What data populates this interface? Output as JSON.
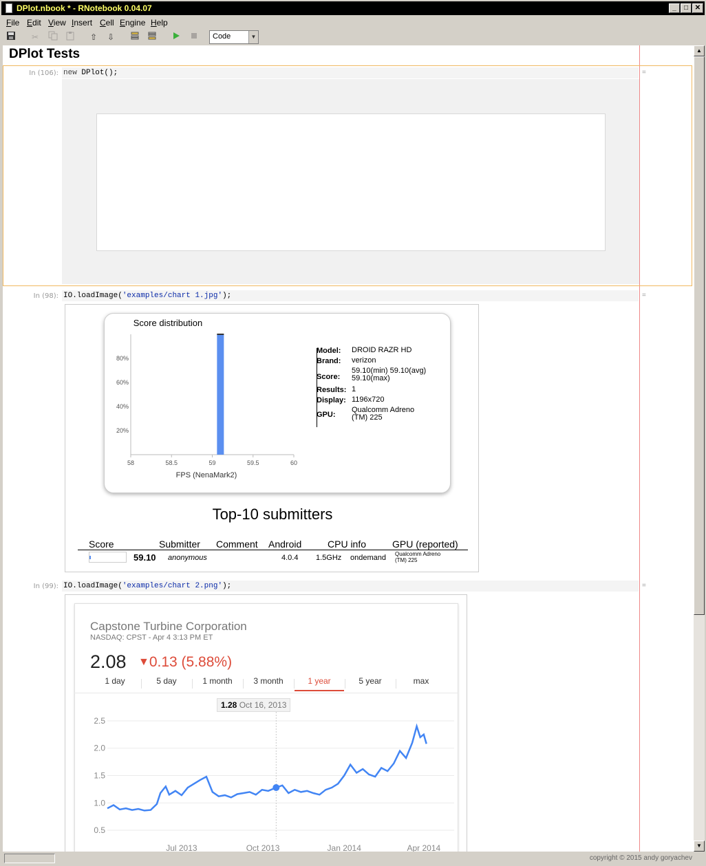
{
  "window": {
    "title": "DPlot.nbook * - RNotebook 0.04.07",
    "controls": {
      "minimize": "_",
      "maximize": "□",
      "close": "✕"
    }
  },
  "menu": [
    "File",
    "Edit",
    "View",
    "Insert",
    "Cell",
    "Engine",
    "Help"
  ],
  "toolbar": {
    "icons": [
      "save-icon",
      "cut-icon",
      "copy-icon",
      "paste-icon",
      "move-up-icon",
      "move-down-icon",
      "insert-above-icon",
      "insert-below-icon",
      "run-icon",
      "stop-icon"
    ],
    "cell_type": "Code"
  },
  "notebook": {
    "title": "DPlot Tests",
    "cells": [
      {
        "prompt": "In (106):",
        "code_kw": "new",
        "code_rest": " DPlot();",
        "marker": "="
      },
      {
        "prompt": "In (98):",
        "code_pre": "IO.loadImage(",
        "code_str": "'examples/chart 1.jpg'",
        "code_post": ");",
        "marker": "="
      },
      {
        "prompt": "In (99):",
        "code_pre": "IO.loadImage(",
        "code_str": "'examples/chart 2.png'",
        "code_post": ");",
        "marker": "="
      }
    ]
  },
  "image1": {
    "info": [
      {
        "key": "Model:",
        "value": "DROID RAZR HD"
      },
      {
        "key": "Brand:",
        "value": "verizon"
      },
      {
        "key": "Score:",
        "value": "59.10(min) 59.10(avg) 59.10(max)"
      },
      {
        "key": "Results:",
        "value": "1"
      },
      {
        "key": "Display:",
        "value": "1196x720"
      },
      {
        "key": "GPU:",
        "value": "Qualcomm Adreno (TM) 225"
      }
    ],
    "top10_title": "Top-10 submitters",
    "table_headers": [
      "Score",
      "Submitter",
      "Comment",
      "Android",
      "CPU info",
      "GPU (reported)"
    ],
    "table_row": {
      "score": "59.10",
      "submitter": "anonymous",
      "android": "4.0.4",
      "cpu_freq": "1.5GHz",
      "cpu_gov": "ondemand",
      "gpu": "Qualcomm Adreno (TM) 225"
    }
  },
  "image2": {
    "company": "Capstone Turbine Corporation",
    "exchange": "NASDAQ: CPST - Apr 4 3:13 PM ET",
    "price": "2.08",
    "change": "0.13 (5.88%)",
    "change_color": "#dd4b39",
    "tabs": [
      "1 day",
      "5 day",
      "1 month",
      "3 month",
      "1 year",
      "5 year",
      "max"
    ],
    "active_tab": "1 year",
    "tooltip_value": "1.28",
    "tooltip_date": "Oct 16, 2013"
  },
  "chart_data": [
    {
      "type": "bar",
      "title": "Score distribution",
      "xlabel": "FPS (NenaMark2)",
      "ylabel": "",
      "x_ticks": [
        "58",
        "58.5",
        "59",
        "59.5",
        "60"
      ],
      "y_ticks": [
        "20%",
        "40%",
        "60%",
        "80%"
      ],
      "xlim": [
        58,
        60
      ],
      "ylim": [
        0,
        100
      ],
      "bars": [
        {
          "x": 59.1,
          "value": 100
        }
      ],
      "bar_color": "#5b8ff0"
    },
    {
      "type": "line",
      "title": "",
      "xlabel": "",
      "ylabel": "",
      "x_ticks": [
        "Jul 2013",
        "Oct 2013",
        "Jan 2014",
        "Apr 2014"
      ],
      "y_ticks": [
        "0.5",
        "1.0",
        "1.5",
        "2.0",
        "2.5"
      ],
      "ylim": [
        0.4,
        2.6
      ],
      "xlim": [
        "2013-04-08",
        "2014-04-04"
      ],
      "series": [
        {
          "color": "#4285f4",
          "x": [
            "2013-04-08",
            "2013-04-15",
            "2013-04-22",
            "2013-04-29",
            "2013-05-06",
            "2013-05-13",
            "2013-05-20",
            "2013-05-27",
            "2013-06-03",
            "2013-06-07",
            "2013-06-13",
            "2013-06-17",
            "2013-06-24",
            "2013-07-01",
            "2013-07-08",
            "2013-07-15",
            "2013-07-22",
            "2013-07-29",
            "2013-08-05",
            "2013-08-12",
            "2013-08-19",
            "2013-08-26",
            "2013-09-02",
            "2013-09-09",
            "2013-09-16",
            "2013-09-23",
            "2013-09-30",
            "2013-10-07",
            "2013-10-16",
            "2013-10-23",
            "2013-10-30",
            "2013-11-06",
            "2013-11-13",
            "2013-11-20",
            "2013-11-27",
            "2013-12-04",
            "2013-12-11",
            "2013-12-18",
            "2013-12-25",
            "2014-01-01",
            "2014-01-08",
            "2014-01-15",
            "2014-01-22",
            "2014-01-29",
            "2014-02-05",
            "2014-02-12",
            "2014-02-19",
            "2014-02-26",
            "2014-03-05",
            "2014-03-12",
            "2014-03-19",
            "2014-03-24",
            "2014-03-28",
            "2014-04-01",
            "2014-04-04"
          ],
          "y": [
            0.9,
            0.96,
            0.88,
            0.9,
            0.87,
            0.89,
            0.86,
            0.87,
            0.98,
            1.18,
            1.3,
            1.15,
            1.22,
            1.14,
            1.28,
            1.35,
            1.42,
            1.48,
            1.2,
            1.12,
            1.14,
            1.1,
            1.16,
            1.18,
            1.2,
            1.15,
            1.24,
            1.22,
            1.28,
            1.32,
            1.18,
            1.24,
            1.2,
            1.22,
            1.18,
            1.15,
            1.24,
            1.28,
            1.35,
            1.5,
            1.7,
            1.55,
            1.62,
            1.52,
            1.48,
            1.64,
            1.58,
            1.72,
            1.95,
            1.82,
            2.1,
            2.4,
            2.2,
            2.25,
            2.08
          ]
        }
      ],
      "marker": {
        "x": "2013-10-16",
        "y": 1.28
      }
    }
  ],
  "status": {
    "copyright": "copyright © 2015 andy goryachev"
  }
}
